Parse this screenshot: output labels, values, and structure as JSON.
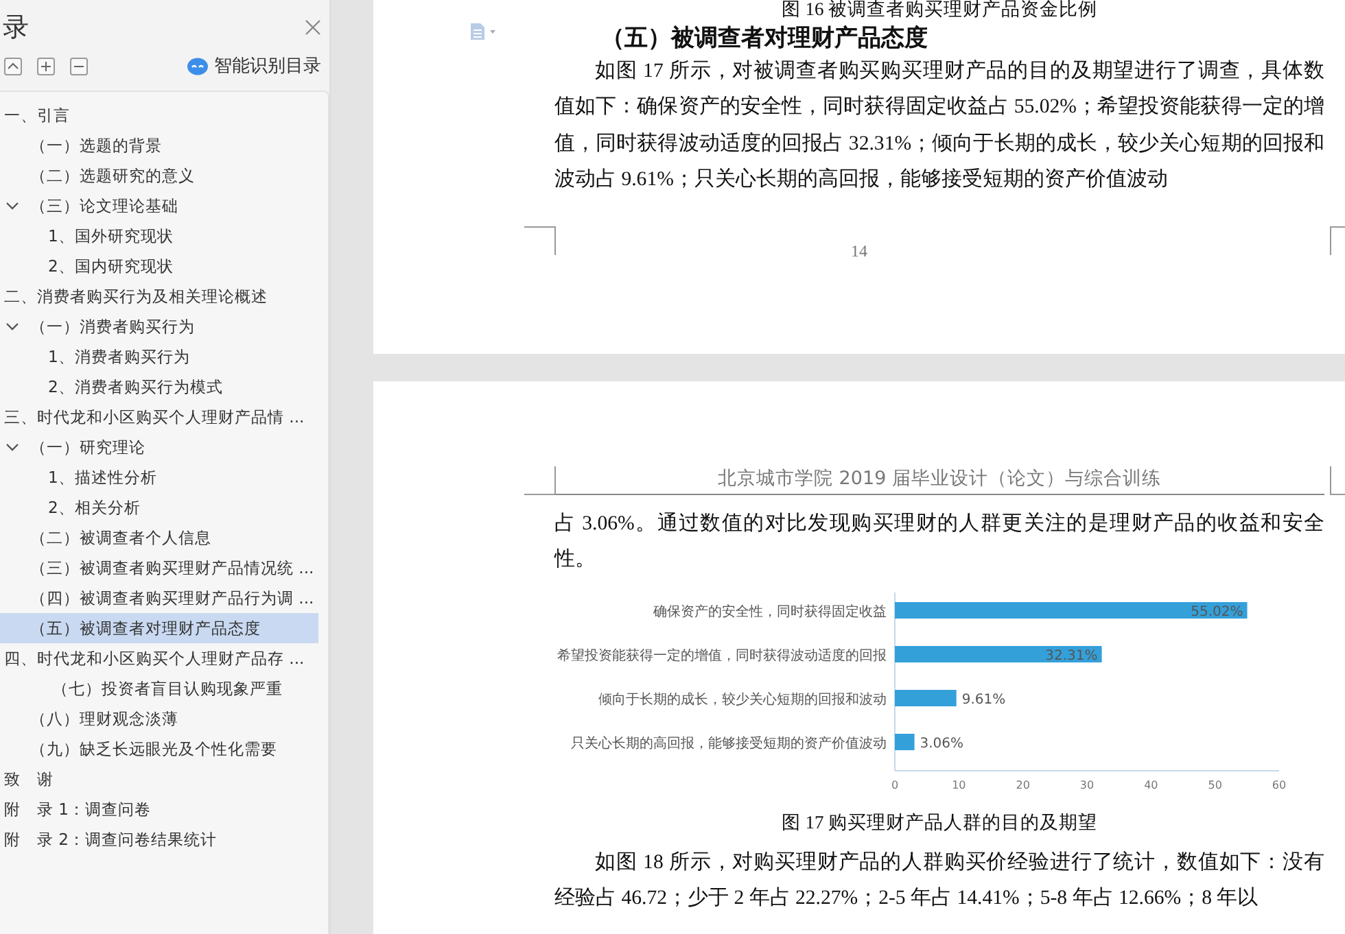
{
  "sidebar": {
    "title": "录",
    "toolbar": {
      "smart_button": "智能识别目录"
    },
    "items": [
      {
        "label": "一、引言",
        "selected": false,
        "children": [
          {
            "label": "（一）选题的背景",
            "selected": false
          },
          {
            "label": "（二）选题研究的意义",
            "selected": false
          },
          {
            "label": "（三）论文理论基础",
            "selected": false,
            "expanded": true,
            "children": [
              {
                "label": "1、国外研究现状",
                "selected": false
              },
              {
                "label": "2、国内研究现状",
                "selected": false
              }
            ]
          }
        ]
      },
      {
        "label": "二、消费者购买行为及相关理论概述",
        "selected": false,
        "children": [
          {
            "label": "（一）消费者购买行为",
            "selected": false,
            "expanded": true,
            "children": [
              {
                "label": "1、消费者购买行为",
                "selected": false
              },
              {
                "label": "2、消费者购买行为模式",
                "selected": false
              }
            ]
          }
        ]
      },
      {
        "label": "三、时代龙和小区购买个人理财产品情 ...",
        "selected": false,
        "children": [
          {
            "label": "（一）研究理论",
            "selected": false,
            "expanded": true,
            "children": [
              {
                "label": "1、描述性分析",
                "selected": false
              },
              {
                "label": "2、相关分析",
                "selected": false
              }
            ]
          },
          {
            "label": "（二）被调查者个人信息",
            "selected": false
          },
          {
            "label": "（三）被调查者购买理财产品情况统 ...",
            "selected": false
          },
          {
            "label": "（四）被调查者购买理财产品行为调 ...",
            "selected": false
          },
          {
            "label": "（五）被调查者对理财产品态度",
            "selected": true
          }
        ]
      },
      {
        "label": "四、时代龙和小区购买个人理财产品存 ...",
        "selected": false,
        "children": [
          {
            "label": "（七）投资者盲目认购现象严重",
            "selected": false,
            "kind": "deep"
          },
          {
            "label": "（八）理财观念淡薄",
            "selected": false
          },
          {
            "label": "（九）缺乏长远眼光及个性化需要",
            "selected": false
          }
        ]
      },
      {
        "label": "致　谢",
        "selected": false
      },
      {
        "label": "附　录 1：调查问卷",
        "selected": false
      },
      {
        "label": "附　录 2：调查问卷结果统计",
        "selected": false
      }
    ]
  },
  "page_1": {
    "caption": "图 16 被调查者购买理财产品资金比例",
    "heading": "（五）被调查者对理财产品态度",
    "paragraph": "如图 17 所示，对被调查者购买购买理财产品的目的及期望进行了调查，具体数值如下：确保资产的安全性，同时获得固定收益占 55.02%；希望投资能获得一定的增值，同时获得波动适度的回报占 32.31%；倾向于长期的成长，较少关心短期的回报和波动占 9.61%；只关心长期的高回报，能够接受短期的资产价值波动",
    "page_number": "14"
  },
  "page_2": {
    "header": "北京城市学院 2019 届毕业设计（论文）与综合训练",
    "paragraph_1": "占 3.06%。通过数值的对比发现购买理财的人群更关注的是理财产品的收益和安全性。",
    "chart_data": {
      "type": "bar",
      "orientation": "horizontal",
      "categories": [
        "确保资产的安全性，同时获得固定收益",
        "希望投资能获得一定的增值，同时获得波动适度的回报",
        "倾向于长期的成长，较少关心短期的回报和波动",
        "只关心长期的高回报，能够接受短期的资产价值波动"
      ],
      "series": [
        {
          "color": "#34a0da",
          "values": [
            55.02,
            32.31,
            9.61,
            3.06
          ]
        }
      ],
      "xlim": [
        0,
        60
      ],
      "xticks": [
        0,
        10,
        20,
        30,
        40,
        50,
        60
      ],
      "value_labels": [
        "55.02%",
        "32.31%",
        "9.61%",
        "3.06%"
      ]
    },
    "caption": "图 17 购买理财产品人群的目的及期望",
    "paragraph_2": "如图 18 所示，对购买理财产品的人群购买价经验进行了统计，数值如下：没有经验占 46.72；少于 2 年占 22.27%；2-5 年占 14.41%；5-8 年占 12.66%；8 年以"
  }
}
